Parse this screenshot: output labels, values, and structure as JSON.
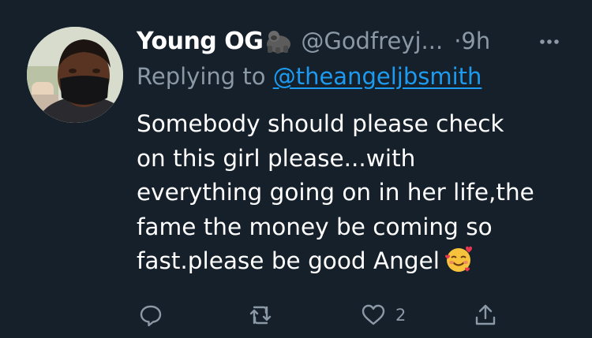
{
  "tweet": {
    "display_name": "Young OG",
    "name_emoji": "gorilla-emoji",
    "handle": "@Godfreyj...",
    "time_separator": "·",
    "time": "9h",
    "replying_prefix": "Replying to ",
    "replying_to": "@theangeljbsmith",
    "body_lines": [
      "Somebody should please check",
      "on this girl please...with",
      "everything going on in her life,the",
      "fame the money be coming so",
      "fast.please be good Angel"
    ],
    "body_emoji": "smiling-face-with-hearts-emoji"
  },
  "actions": {
    "reply": {
      "icon": "reply-icon",
      "count": ""
    },
    "retweet": {
      "icon": "retweet-icon",
      "count": ""
    },
    "like": {
      "icon": "heart-icon",
      "count": "2"
    },
    "share": {
      "icon": "share-icon",
      "count": ""
    }
  },
  "colors": {
    "background": "#15202b",
    "secondary_text": "#8b98a5",
    "link": "#1d9bf0",
    "primary_text": "#ffffff"
  }
}
